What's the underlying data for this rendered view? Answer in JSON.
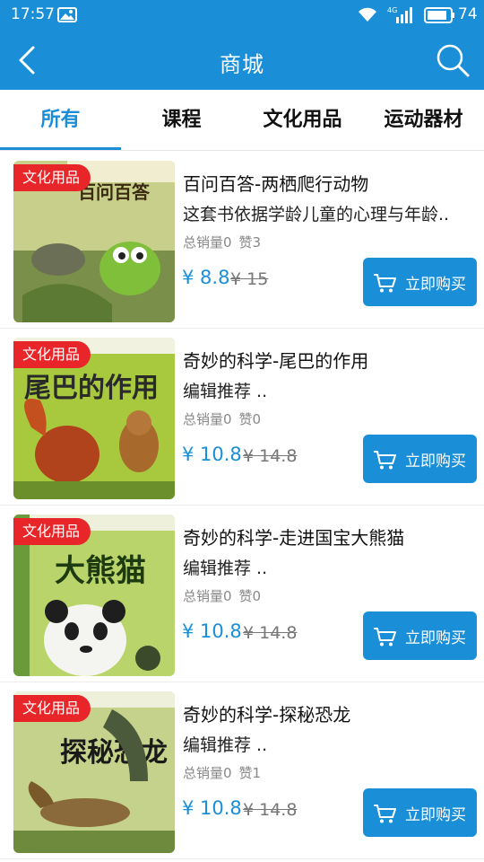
{
  "status_bar": {
    "time": "17:57",
    "battery": "74",
    "network": "4G",
    "icons": [
      "image-icon",
      "wifi-icon",
      "signal-icon",
      "battery-icon"
    ]
  },
  "header": {
    "title": "商城",
    "back_icon": "chevron-left-icon",
    "search_icon": "search-icon"
  },
  "tabs": [
    {
      "label": "所有",
      "active": true
    },
    {
      "label": "课程",
      "active": false
    },
    {
      "label": "文化用品",
      "active": false
    },
    {
      "label": "运动器材",
      "active": false
    }
  ],
  "products": [
    {
      "badge": "文化用品",
      "name": "百问百答-两栖爬行动物",
      "desc": "这套书依据学龄儿童的心理与年龄..",
      "sales": "总销量0",
      "likes": "赞3",
      "price": "¥ 8.8",
      "orig_price": "¥ 15",
      "buy_label": "立即购买",
      "cover_text": "百问百答"
    },
    {
      "badge": "文化用品",
      "name": "奇妙的科学-尾巴的作用",
      "desc": "编辑推荐 ..",
      "sales": "总销量0",
      "likes": "赞0",
      "price": "¥ 10.8",
      "orig_price": "¥ 14.8",
      "buy_label": "立即购买",
      "cover_text": "尾巴的作用"
    },
    {
      "badge": "文化用品",
      "name": "奇妙的科学-走进国宝大熊猫",
      "desc": "编辑推荐 ..",
      "sales": "总销量0",
      "likes": "赞0",
      "price": "¥ 10.8",
      "orig_price": "¥ 14.8",
      "buy_label": "立即购买",
      "cover_text": "大熊猫"
    },
    {
      "badge": "文化用品",
      "name": "奇妙的科学-探秘恐龙",
      "desc": "编辑推荐 ..",
      "sales": "总销量0",
      "likes": "赞1",
      "price": "¥ 10.8",
      "orig_price": "¥ 14.8",
      "buy_label": "立即购买",
      "cover_text": "探秘恐龙"
    }
  ],
  "colors": {
    "primary": "#1a8fd8",
    "badge": "#e8262a",
    "price": "#1a8fd8"
  }
}
